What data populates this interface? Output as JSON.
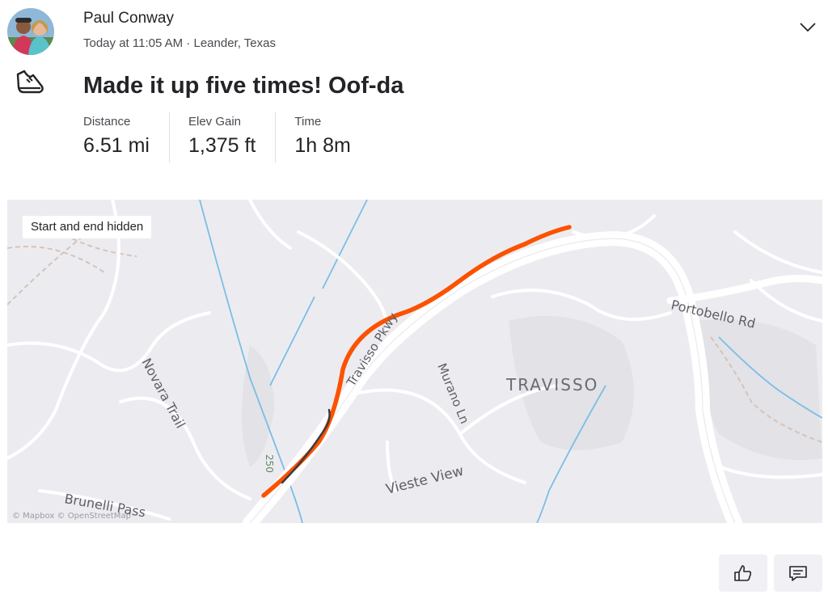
{
  "athlete": {
    "name": "Paul Conway"
  },
  "activity": {
    "time": "Today at 11:05 AM",
    "separator": " · ",
    "location": "Leander, Texas",
    "title": "Made it up five times! Oof-da",
    "sport_icon": "run-shoe-icon"
  },
  "stats": [
    {
      "label": "Distance",
      "value": "6.51 mi"
    },
    {
      "label": "Elev Gain",
      "value": "1,375 ft"
    },
    {
      "label": "Time",
      "value": "1h 8m"
    }
  ],
  "map": {
    "privacy_badge": "Start and end hidden",
    "labels": {
      "travisso_pkwy": "Travisso Pkwy",
      "portobello": "Portobello Rd",
      "travisso": "TRAVISSO",
      "novara": "Novara Trail",
      "murano": "Murano Ln",
      "vieste": "Vieste View",
      "brunelli": "Brunelli Pass",
      "road_250": "250",
      "attribution": "© Mapbox © OpenStreetMap"
    },
    "route_color": "#fc5200"
  },
  "actions": {
    "kudos_icon": "thumbs-up-icon",
    "comment_icon": "comment-icon"
  },
  "colors": {
    "accent": "#fc5200",
    "text": "#242428",
    "muted": "#494950"
  }
}
